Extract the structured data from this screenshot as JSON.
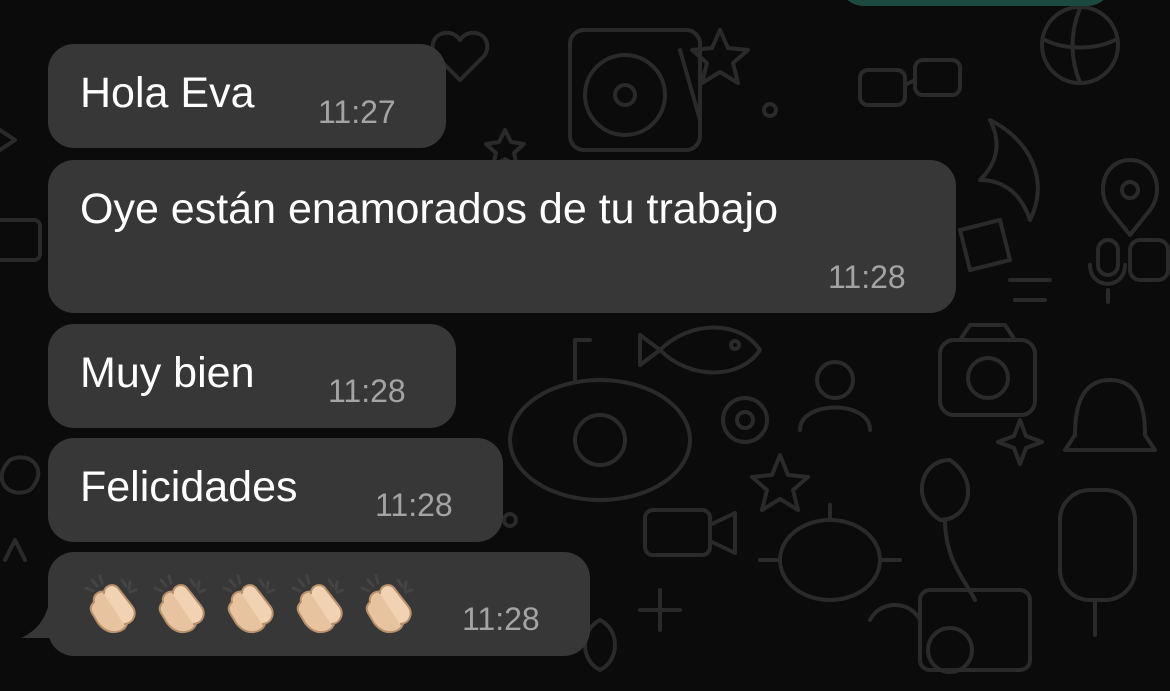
{
  "chat": {
    "outgoing_preview": {
      "color": "#1d4a40"
    },
    "messages": [
      {
        "id": "m1",
        "text": "Hola Eva",
        "time": "11:27"
      },
      {
        "id": "m2",
        "text": "Oye están enamorados de tu trabajo",
        "time": "11:28"
      },
      {
        "id": "m3",
        "text": "Muy bien",
        "time": "11:28"
      },
      {
        "id": "m4",
        "text": "Felicidades",
        "time": "11:28"
      },
      {
        "id": "m5",
        "emoji": "clapping-hands",
        "emoji_count": 5,
        "time": "11:28"
      }
    ]
  },
  "colors": {
    "background": "#0b0b0b",
    "incoming_bubble": "#373737",
    "message_text": "#ffffff",
    "timestamp_text": "#a4a4a4",
    "wallpaper_doodles": "#2a2a2a"
  }
}
